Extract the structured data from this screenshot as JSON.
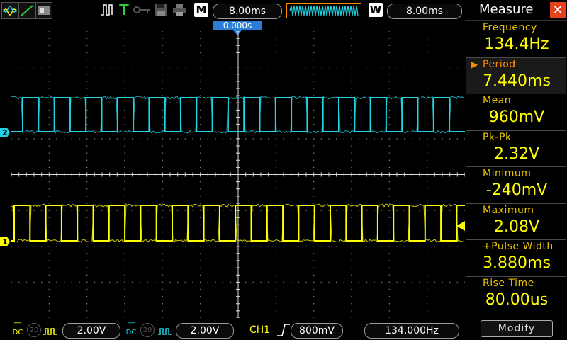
{
  "top": {
    "mode_letter": "M",
    "main_timebase": "8.00ms",
    "window_letter": "W",
    "window_timebase": "8.00ms",
    "trigger_position": "0.000s",
    "trigger_letter": "T"
  },
  "channels": {
    "ch2_marker": "2",
    "ch1_marker": "1"
  },
  "measure": {
    "title": "Measure",
    "close_symbol": "✕",
    "items": [
      {
        "label": "Frequency",
        "value": "134.4Hz"
      },
      {
        "label": "Period",
        "value": "7.440ms"
      },
      {
        "label": "Mean",
        "value": "960mV"
      },
      {
        "label": "Pk-Pk",
        "value": "2.32V"
      },
      {
        "label": "Minimum",
        "value": "-240mV"
      },
      {
        "label": "Maximum",
        "value": "2.08V"
      },
      {
        "label": "+Pulse Width",
        "value": "3.880ms"
      },
      {
        "label": "Rise Time",
        "value": "80.00us"
      }
    ],
    "active_marker": "▶",
    "modify_label": "Modify"
  },
  "bottom": {
    "ch1_coupling": "DC",
    "ch1_scale": "2.00V",
    "ch2_coupling": "DC",
    "ch2_scale": "2.00V",
    "trigger_source": "CH1",
    "trigger_level": "800mV",
    "frequency": "134.000Hz",
    "bw_limit": "20"
  },
  "colors": {
    "ch1": "#ffff00",
    "ch2": "#22d3e6",
    "accent": "#e8401c",
    "trigger_marker": "#ff8c00"
  }
}
